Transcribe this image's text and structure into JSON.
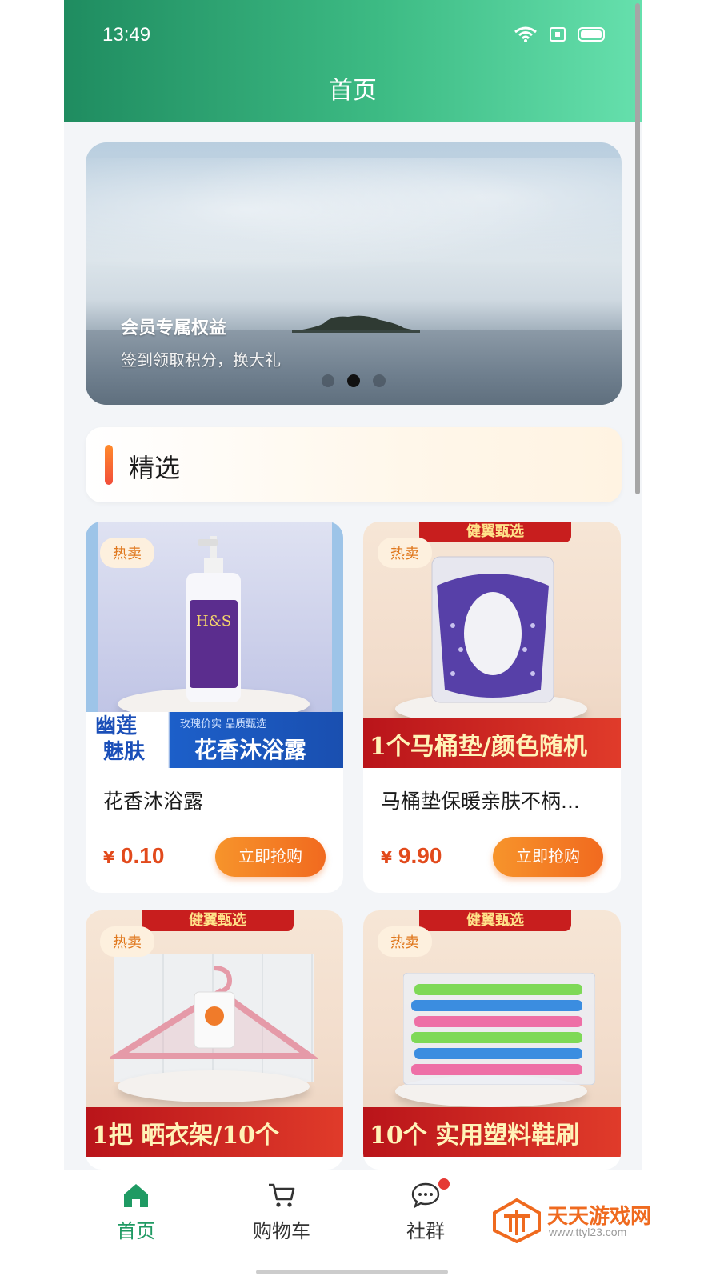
{
  "status": {
    "time": "13:49"
  },
  "header": {
    "title": "首页"
  },
  "banner": {
    "title": "会员专属权益",
    "subtitle": "签到领取积分，换大礼",
    "dots": 3,
    "active_dot": 1
  },
  "section": {
    "title": "精选"
  },
  "products": [
    {
      "badge": "热卖",
      "name": "花香沐浴露",
      "currency": "¥",
      "price": "0.10",
      "button": "立即抢购",
      "image_text": [
        "幽莲",
        "魅肤",
        "花香沐浴露",
        "玫瑰价实 品质甄选"
      ]
    },
    {
      "badge": "热卖",
      "name": "马桶垫保暖亲肤不柄...",
      "currency": "¥",
      "price": "9.90",
      "button": "立即抢购",
      "image_text": [
        "健翼甄选",
        "1个马桶垫/颜色随机"
      ]
    },
    {
      "badge": "热卖",
      "image_text": [
        "健翼甄选",
        "1把 晒衣架/10个"
      ]
    },
    {
      "badge": "热卖",
      "image_text": [
        "健翼甄选",
        "10个 实用塑料鞋刷"
      ]
    }
  ],
  "tabs": [
    {
      "label": "首页",
      "icon": "home-icon",
      "active": true
    },
    {
      "label": "购物车",
      "icon": "cart-icon",
      "active": false
    },
    {
      "label": "社群",
      "icon": "chat-icon",
      "active": false,
      "has_notification": true
    }
  ],
  "watermark": {
    "name": "天天游戏网",
    "url": "www.ttyl23.com"
  },
  "colors": {
    "primary": "#1f9a63",
    "accent": "#f16a1f",
    "price": "#e24a1c"
  }
}
